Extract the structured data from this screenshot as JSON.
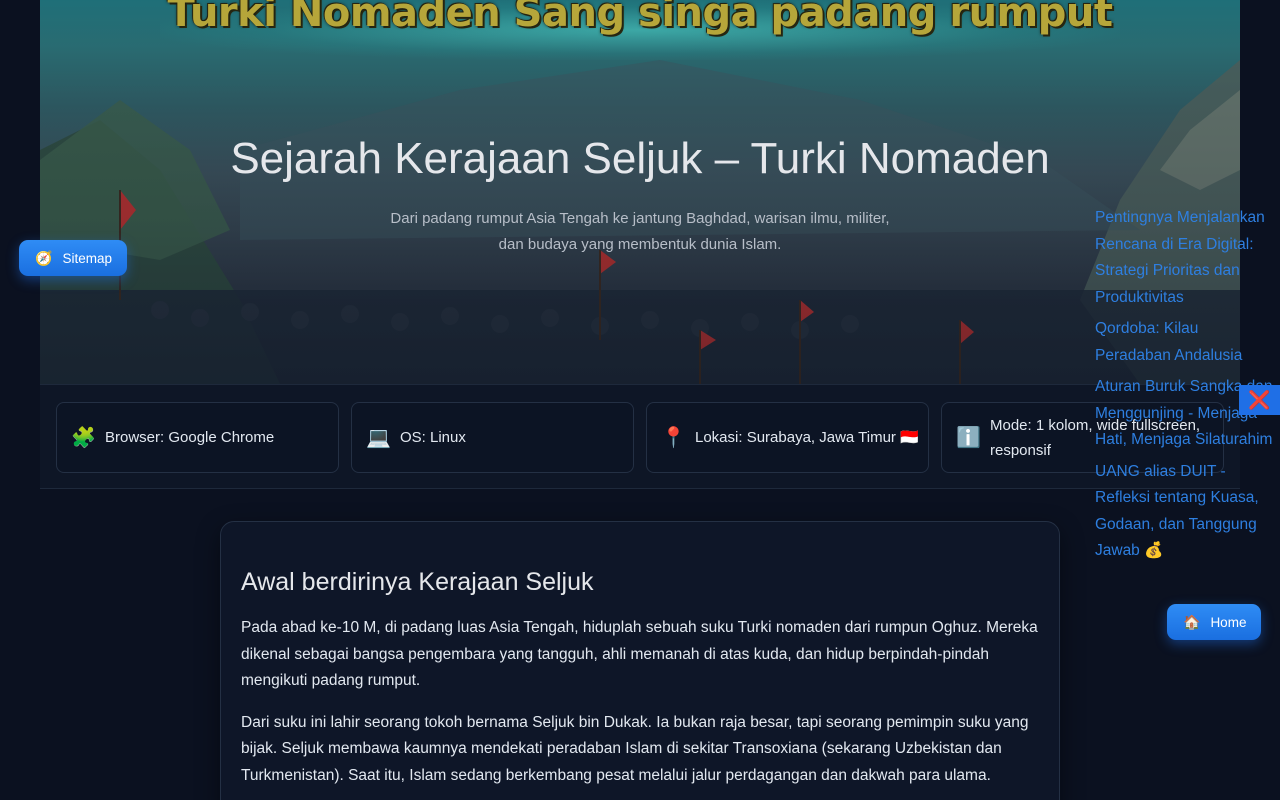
{
  "hero": {
    "banner_text": "Turki Nomaden Sang singa padang rumput",
    "title": "Sejarah Kerajaan Seljuk – Turki Nomaden",
    "subtitle": "Dari padang rumput Asia Tengah ke jantung Baghdad, warisan ilmu, militer, dan budaya yang membentuk dunia Islam."
  },
  "info_cards": [
    {
      "icon": "puzzle-icon",
      "glyph": "🧩",
      "text": "Browser: Google Chrome"
    },
    {
      "icon": "laptop-icon",
      "glyph": "💻",
      "text": "OS: Linux"
    },
    {
      "icon": "pin-icon",
      "glyph": "📍",
      "text": "Lokasi: Surabaya, Jawa Timur 🇮🇩"
    },
    {
      "icon": "info-icon",
      "glyph": "ℹ️",
      "text": "Mode: 1 kolom, wide fullscreen, responsif"
    }
  ],
  "article": {
    "heading": "Awal berdirinya Kerajaan Seljuk",
    "paragraphs": [
      "Pada abad ke-10 M, di padang luas Asia Tengah, hiduplah sebuah suku Turki nomaden dari rumpun Oghuz. Mereka dikenal sebagai bangsa pengembara yang tangguh, ahli memanah di atas kuda, dan hidup berpindah-pindah mengikuti padang rumput.",
      "Dari suku ini lahir seorang tokoh bernama Seljuk bin Dukak. Ia bukan raja besar, tapi seorang pemimpin suku yang bijak. Seljuk membawa kaumnya mendekati peradaban Islam di sekitar Transoxiana (sekarang Uzbekistan dan Turkmenistan). Saat itu, Islam sedang berkembang pesat melalui jalur perdagangan dan dakwah para ulama."
    ]
  },
  "side_links": [
    "Pentingnya Menjalankan Rencana di Era Digital: Strategi Prioritas dan Produktivitas",
    "Qordoba: Kilau Peradaban Andalusia",
    "Aturan Buruk Sangka dan Menggunjing - Menjaga Hati, Menjaga Silaturahim",
    "UANG alias DUIT - Refleksi tentang Kuasa, Godaan, dan Tanggung Jawab 💰"
  ],
  "buttons": {
    "sitemap": {
      "icon": "compass-icon",
      "glyph": "🧭",
      "label": "Sitemap"
    },
    "home": {
      "icon": "house-icon",
      "glyph": "🏠",
      "label": "Home"
    },
    "close": {
      "icon": "close-icon",
      "glyph": "❌"
    }
  }
}
